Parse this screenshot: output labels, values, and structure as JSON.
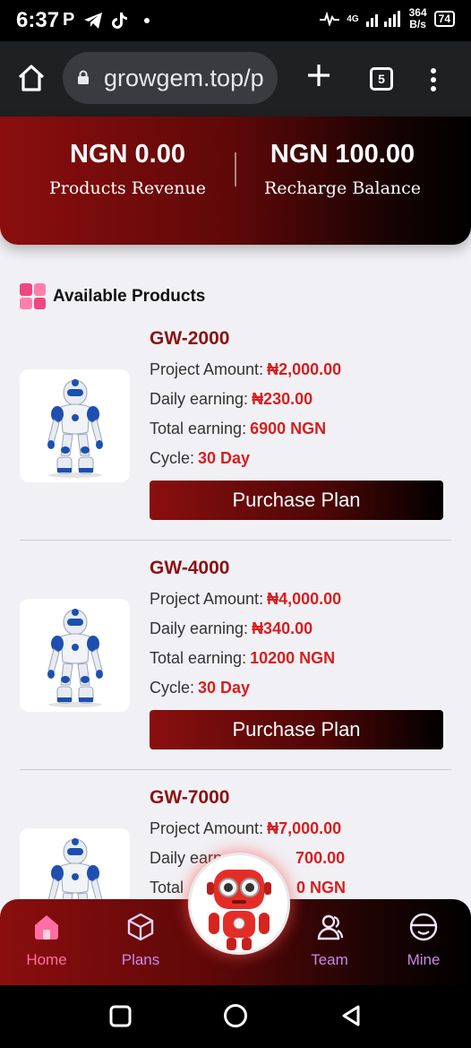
{
  "status_bar": {
    "time": "6:37",
    "left_icons": [
      "P",
      "telegram-icon",
      "tiktok-icon"
    ],
    "network_type": "4G",
    "net_speed_value": "364",
    "net_speed_unit": "B/s",
    "battery": "74"
  },
  "browser": {
    "url": "growgem.top/p",
    "tab_count": "5"
  },
  "header": {
    "products_revenue_value": "NGN 0.00",
    "products_revenue_label": "Products Revenue",
    "recharge_balance_value": "NGN 100.00",
    "recharge_balance_label": "Recharge Balance"
  },
  "section_title": "Available Products",
  "labels": {
    "project_amount": "Project Amount:",
    "daily_earning": "Daily earning:",
    "total_earning": "Total earning:",
    "cycle": "Cycle:",
    "purchase_button": "Purchase Plan"
  },
  "products": [
    {
      "name": "GW-2000",
      "project_amount": "₦2,000.00",
      "daily_earning": "₦230.00",
      "total_earning": "6900 NGN",
      "cycle": "30 Day"
    },
    {
      "name": "GW-4000",
      "project_amount": "₦4,000.00",
      "daily_earning": "₦340.00",
      "total_earning": "10200 NGN",
      "cycle": "30 Day"
    },
    {
      "name": "GW-7000",
      "project_amount": "₦7,000.00",
      "daily_earning_partial": "700.00",
      "total_earning_partial": "0 NGN",
      "daily_label_partial": "Daily earn",
      "total_label_partial": "Total"
    }
  ],
  "bottom_nav": {
    "items": [
      {
        "label": "Home",
        "icon": "home-icon",
        "color": "#ff6fa3"
      },
      {
        "label": "Plans",
        "icon": "cube-icon",
        "color": "#c58be8"
      },
      {
        "label": "Team",
        "icon": "team-icon",
        "color": "#c58be8"
      },
      {
        "label": "Mine",
        "icon": "face-icon",
        "color": "#c58be8"
      }
    ]
  },
  "colors": {
    "accent_red": "#8b1212",
    "value_red": "#d71e1e",
    "nav_active": "#ff6fa3",
    "nav_inactive": "#c58be8"
  }
}
